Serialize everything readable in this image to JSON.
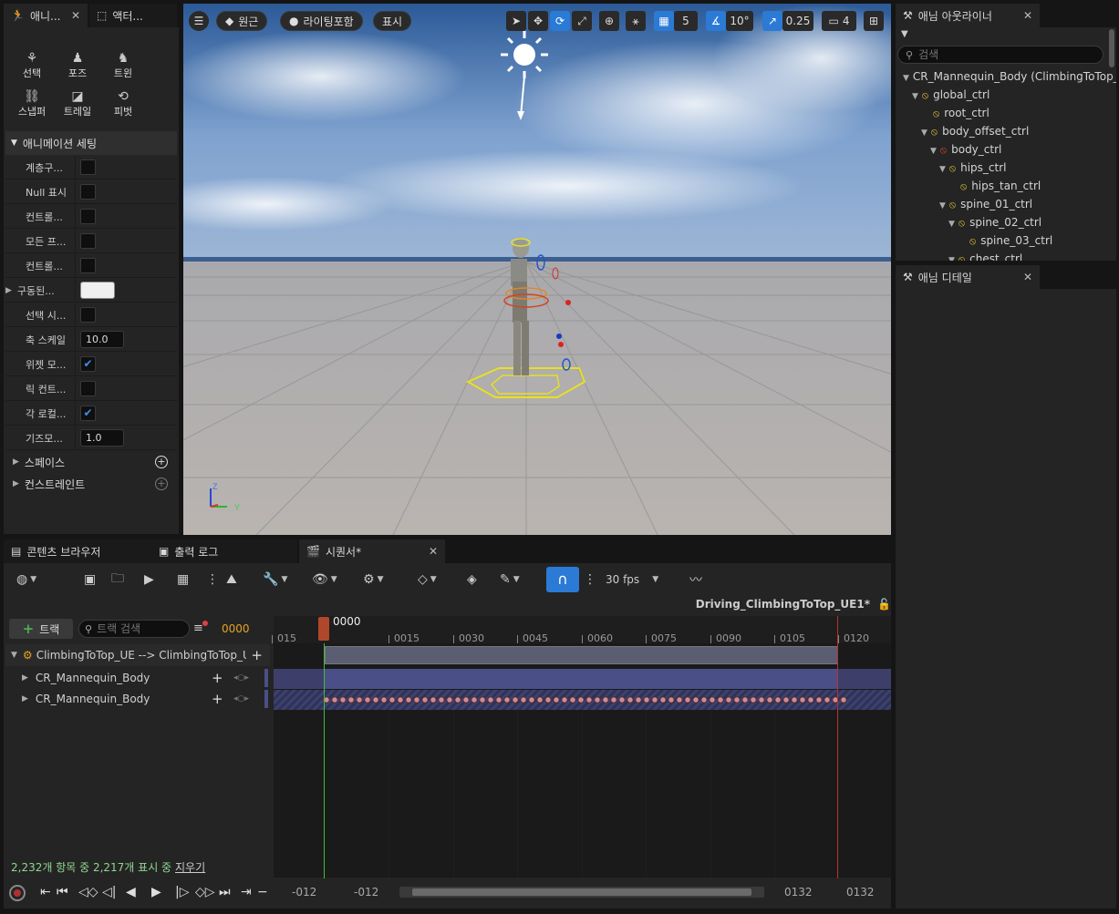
{
  "left_tabs": {
    "anim": "애니...",
    "actor": "액터..."
  },
  "tools": [
    {
      "label": "선택",
      "icon": "select-tool-icon"
    },
    {
      "label": "포즈",
      "icon": "pose-tool-icon"
    },
    {
      "label": "트윈",
      "icon": "tween-tool-icon"
    },
    {
      "label": "스냅퍼",
      "icon": "snapper-tool-icon"
    },
    {
      "label": "트레일",
      "icon": "trail-tool-icon"
    },
    {
      "label": "피벗",
      "icon": "pivot-tool-icon"
    }
  ],
  "anim_settings": {
    "header": "애니메이션 세팅",
    "rows": [
      {
        "label": "계층구...",
        "type": "check",
        "checked": false
      },
      {
        "label": "Null 표시",
        "type": "check",
        "checked": false
      },
      {
        "label": "컨트롤...",
        "type": "check",
        "checked": false
      },
      {
        "label": "모든 프...",
        "type": "check",
        "checked": false
      },
      {
        "label": "컨트롤...",
        "type": "check",
        "checked": false
      },
      {
        "label": "구동된...",
        "type": "color",
        "value": "#f0f0f0"
      },
      {
        "label": "선택 시...",
        "type": "check",
        "checked": false
      },
      {
        "label": "축 스케일",
        "type": "number",
        "value": "10.0"
      },
      {
        "label": "위젯 모...",
        "type": "check",
        "checked": true
      },
      {
        "label": "릭 컨트...",
        "type": "check",
        "checked": false
      },
      {
        "label": "각 로컬...",
        "type": "check",
        "checked": true
      },
      {
        "label": "기즈모...",
        "type": "number",
        "value": "1.0"
      }
    ],
    "spaces": "스페이스",
    "constraints": "컨스트레인트"
  },
  "viewport": {
    "perspective": "원근",
    "lighting": "라이팅포함",
    "show": "표시",
    "grid_value": "5",
    "angle_value": "10°",
    "scale_value": "0.25",
    "camera_speed": "4"
  },
  "outliner": {
    "tab": "애님 아웃라이너",
    "search_placeholder": "검색",
    "items": [
      {
        "label": "CR_Mannequin_Body  (ClimbingToTop_UE)",
        "indent": 0,
        "arrow": true,
        "bone": false
      },
      {
        "label": "global_ctrl",
        "indent": 1,
        "arrow": true,
        "bone": true
      },
      {
        "label": "root_ctrl",
        "indent": 2,
        "arrow": false,
        "bone": true
      },
      {
        "label": "body_offset_ctrl",
        "indent": 2,
        "arrow": true,
        "bone": true
      },
      {
        "label": "body_ctrl",
        "indent": 3,
        "arrow": true,
        "bone": true
      },
      {
        "label": "hips_ctrl",
        "indent": 4,
        "arrow": true,
        "bone": true
      },
      {
        "label": "hips_tan_ctrl",
        "indent": 5,
        "arrow": false,
        "bone": true
      },
      {
        "label": "spine_01_ctrl",
        "indent": 4,
        "arrow": true,
        "bone": true
      },
      {
        "label": "spine_02_ctrl",
        "indent": 5,
        "arrow": true,
        "bone": true
      },
      {
        "label": "spine_03_ctrl",
        "indent": 6,
        "arrow": false,
        "bone": true
      },
      {
        "label": "chest_ctrl",
        "indent": 5,
        "arrow": true,
        "bone": true
      }
    ]
  },
  "details_tab": "애님 디테일",
  "bottom_tabs": {
    "content": "콘텐츠 브라우저",
    "log": "출력 로그",
    "sequencer": "시퀀서*"
  },
  "sequencer": {
    "fps": "30 fps",
    "sequence_name": "Driving_ClimbingToTop_UE1*",
    "add_track": "트랙",
    "search_placeholder": "트랙 검색",
    "current_frame": "0000",
    "playhead": "0000",
    "tracks": [
      {
        "label": "ClimbingToTop_UE --> ClimbingToTop_UE"
      },
      {
        "label": "CR_Mannequin_Body"
      },
      {
        "label": "CR_Mannequin_Body"
      }
    ],
    "ticks": [
      "015",
      "0015",
      "0030",
      "0045",
      "0060",
      "0075",
      "0090",
      "0105",
      "0120"
    ],
    "status": "2,232개 항목 중 2,217개 표시 중",
    "clear": "지우기",
    "range_start_1": "-012",
    "range_start_2": "-012",
    "range_end_1": "0132",
    "range_end_2": "0132"
  },
  "colors": {
    "accent": "#2b7ad6",
    "playhead": "#b0472b",
    "section": "#4a4f88",
    "track_base": "#5b5e73"
  }
}
